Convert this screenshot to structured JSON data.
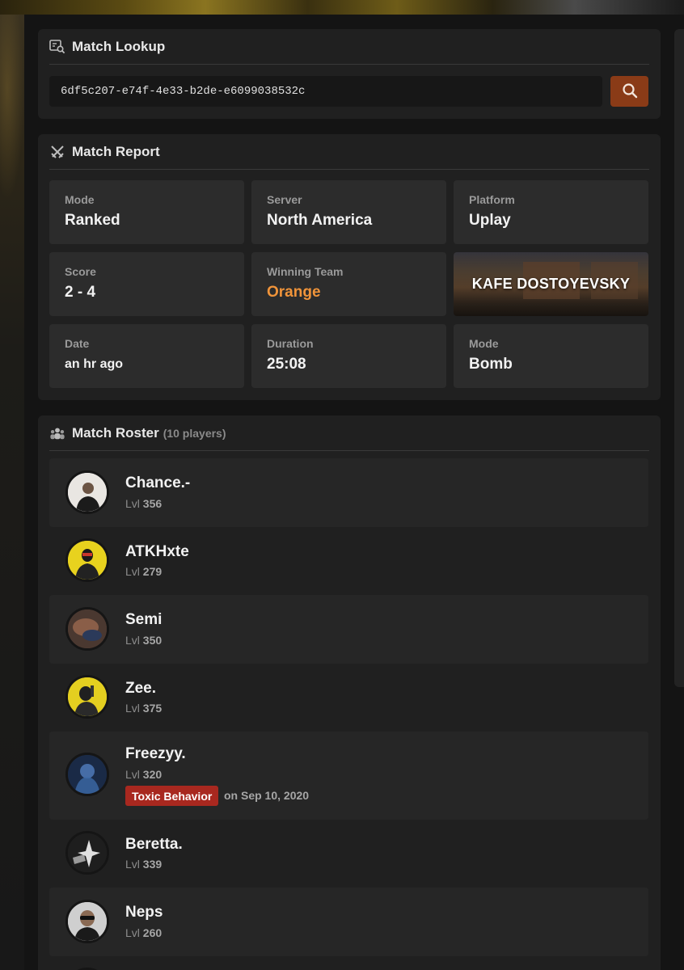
{
  "lookup": {
    "title": "Match Lookup",
    "input_value": "6df5c207-e74f-4e33-b2de-e6099038532c",
    "search_icon": "search-icon",
    "button_color": "#8a3b17"
  },
  "report": {
    "title": "Match Report",
    "stats": [
      {
        "label": "Mode",
        "value": "Ranked"
      },
      {
        "label": "Server",
        "value": "North America"
      },
      {
        "label": "Platform",
        "value": "Uplay"
      },
      {
        "label": "Score",
        "value": "2 - 4"
      },
      {
        "label": "Winning Team",
        "value": "Orange",
        "color": "#f0943a"
      },
      {
        "label": "Date",
        "value": "an hr ago"
      },
      {
        "label": "Duration",
        "value": "25:08"
      },
      {
        "label": "Mode",
        "value": "Bomb"
      }
    ],
    "map_name": "KAFE DOSTOYEVSKY"
  },
  "roster": {
    "title": "Match Roster",
    "count_label": "(10 players)",
    "level_prefix": "Lvl",
    "players": [
      {
        "name": "Chance.-",
        "level": "356"
      },
      {
        "name": "ATKHxte",
        "level": "279"
      },
      {
        "name": "Semi",
        "level": "350"
      },
      {
        "name": "Zee.",
        "level": "375"
      },
      {
        "name": "Freezyy.",
        "level": "320",
        "flag": "Toxic Behavior",
        "flag_date": "on Sep 10, 2020"
      },
      {
        "name": "Beretta.",
        "level": "339"
      },
      {
        "name": "Neps",
        "level": "260"
      }
    ]
  }
}
